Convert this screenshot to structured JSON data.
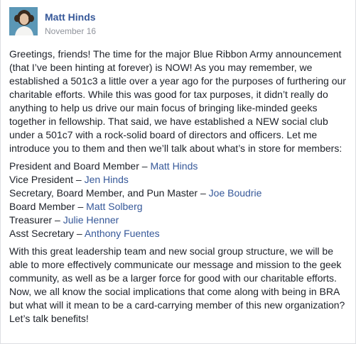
{
  "post": {
    "author": "Matt Hinds",
    "date": "November 16",
    "intro": "Greetings, friends! The time for the major Blue Ribbon Army announcement (that I’ve been hinting at forever) is NOW! As you may remember, we established a 501c3 a little over a year ago for the purposes of furthering our charitable efforts. While this was good for tax purposes, it didn’t really do anything to help us drive our main focus of bringing like-minded geeks together in fellowship. That said, we have established a NEW social club under a 501c7 with a rock-solid board of directors and officers. Let me introduce you to them and then we’ll talk about what’s in store for members:",
    "roles": [
      {
        "title": "President and Board Member – ",
        "name": "Matt Hinds"
      },
      {
        "title": "Vice President – ",
        "name": "Jen Hinds"
      },
      {
        "title": "Secretary, Board Member, and Pun Master – ",
        "name": "Joe Boudrie"
      },
      {
        "title": "Board Member – ",
        "name": "Matt Solberg"
      },
      {
        "title": "Treasurer – ",
        "name": "Julie Henner"
      },
      {
        "title": "Asst Secretary – ",
        "name": "Anthony Fuentes"
      }
    ],
    "closing": "With this great leadership team and new social group structure, we will be able to more effectively communicate our message and mission to the geek community, as well as be a larger force for good with our charitable efforts. Now, we all know the social implications that come along with being in BRA but what will it mean to be a card-carrying member of this new organization? Let’s talk benefits!"
  },
  "colors": {
    "link": "#365899",
    "text": "#1d2129",
    "meta": "#90949c"
  }
}
